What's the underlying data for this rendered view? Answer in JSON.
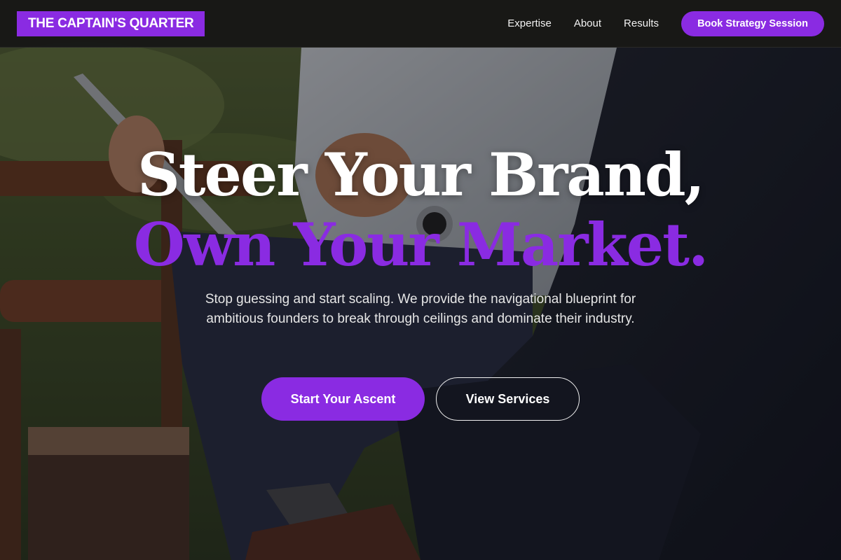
{
  "brand": {
    "name": "THE CAPTAIN'S QUARTER",
    "accent_color": "#8a2be2"
  },
  "nav": {
    "links": [
      "Expertise",
      "About",
      "Results"
    ],
    "cta_label": "Book Strategy Session"
  },
  "hero": {
    "headline_line1": "Steer Your Brand,",
    "headline_line2": "Own Your Market.",
    "subtitle": "Stop guessing and start scaling. We provide the navigational blueprint for ambitious founders to break through ceilings and dominate their industry.",
    "primary_button": "Start Your Ascent",
    "secondary_button": "View Services",
    "background": "photo-two-businessmen-seated-outdoors-one-holding-tablet"
  }
}
